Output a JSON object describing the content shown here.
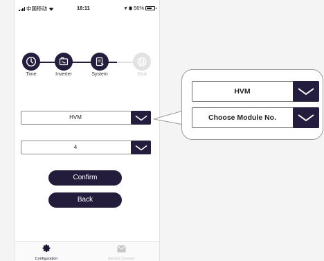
{
  "status_bar": {
    "carrier": "中国移动",
    "time": "18:11",
    "battery": "56%"
  },
  "steps": [
    {
      "label": "Time",
      "icon": "clock-icon",
      "state": "done"
    },
    {
      "label": "Inverter",
      "icon": "inverter-icon",
      "state": "done"
    },
    {
      "label": "System",
      "icon": "system-icon",
      "state": "active"
    },
    {
      "label": "Grid",
      "icon": "globe-icon",
      "state": "disabled"
    }
  ],
  "form": {
    "system_type": "HVM",
    "module_count": "4"
  },
  "buttons": {
    "confirm": "Confirm",
    "back": "Back"
  },
  "tabbar": {
    "configuration": "Configuration",
    "service_contact": "Service Contact"
  },
  "callout": {
    "system_type": "HVM",
    "module_placeholder": "Choose Module No."
  },
  "colors": {
    "accent": "#241d3d",
    "disabled": "#c8c8c8",
    "background": "#f4f4f4"
  }
}
